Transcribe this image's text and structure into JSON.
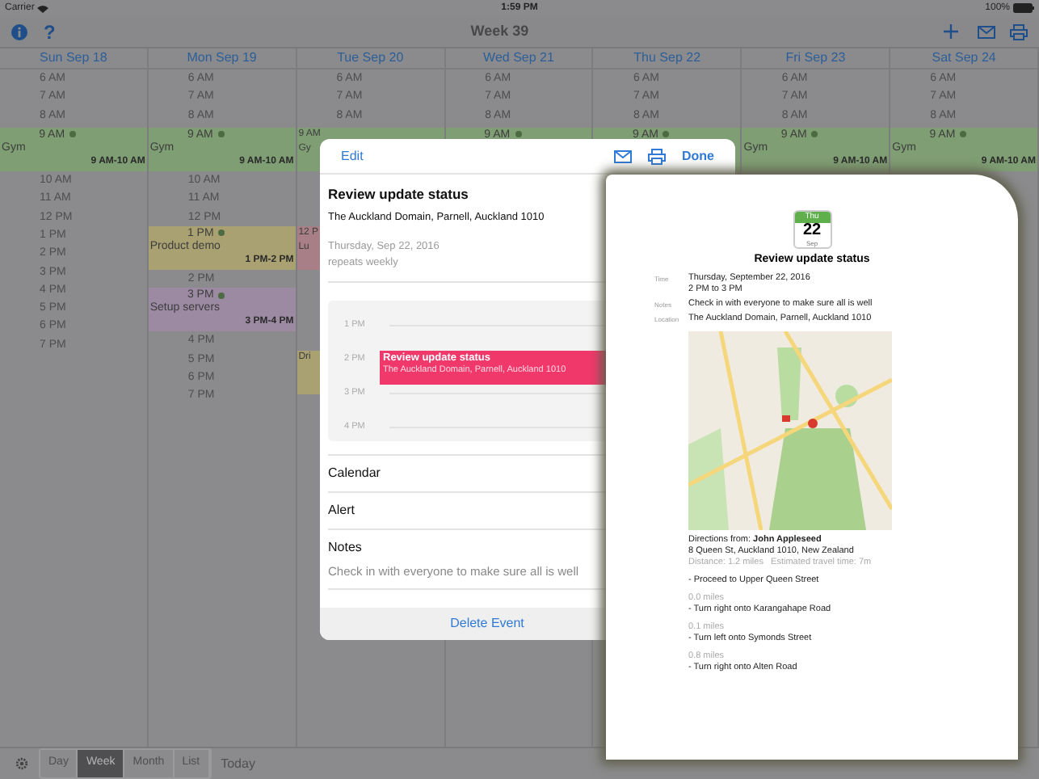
{
  "status_bar": {
    "carrier": "Carrier",
    "time": "1:59 PM",
    "battery": "100%"
  },
  "nav_bar": {
    "help": "?",
    "title": "Week 39"
  },
  "days": [
    {
      "label": "Sun Sep 18",
      "items": [
        {
          "kind": "hour",
          "text": "6 AM"
        },
        {
          "kind": "hour",
          "text": "7 AM"
        },
        {
          "kind": "hour",
          "text": "8 AM"
        },
        {
          "kind": "event",
          "label": "9 AM",
          "name": "Gym",
          "time": "9 AM-10 AM",
          "color": "#7f9e74"
        },
        {
          "kind": "hour",
          "text": "10 AM"
        },
        {
          "kind": "hour",
          "text": "11 AM"
        },
        {
          "kind": "hour",
          "text": "12 PM"
        },
        {
          "kind": "hour",
          "text": "1 PM"
        },
        {
          "kind": "hour",
          "text": "2 PM"
        },
        {
          "kind": "hour",
          "text": "3 PM"
        },
        {
          "kind": "hour",
          "text": "4 PM"
        },
        {
          "kind": "hour",
          "text": "5 PM"
        },
        {
          "kind": "hour",
          "text": "6 PM"
        },
        {
          "kind": "hour",
          "text": "7 PM"
        }
      ]
    },
    {
      "label": "Mon Sep 19",
      "items": [
        {
          "kind": "hour",
          "text": "6 AM"
        },
        {
          "kind": "hour",
          "text": "7 AM"
        },
        {
          "kind": "hour",
          "text": "8 AM"
        },
        {
          "kind": "event",
          "label": "9 AM",
          "name": "Gym",
          "time": "9 AM-10 AM",
          "color": "#7f9e74"
        },
        {
          "kind": "hour",
          "text": "10 AM"
        },
        {
          "kind": "hour",
          "text": "11 AM"
        },
        {
          "kind": "hour",
          "text": "12 PM"
        },
        {
          "kind": "event",
          "label": "1 PM",
          "name": "Product demo",
          "time": "1 PM-2 PM",
          "color": "#a9a171"
        },
        {
          "kind": "hour",
          "text": "2 PM"
        },
        {
          "kind": "event",
          "label": "3 PM",
          "name": "Setup servers",
          "time": "3 PM-4 PM",
          "color": "#9c8aa3"
        },
        {
          "kind": "hour",
          "text": "4 PM"
        },
        {
          "kind": "hour",
          "text": "5 PM"
        },
        {
          "kind": "hour",
          "text": "6 PM"
        },
        {
          "kind": "hour",
          "text": "7 PM"
        }
      ]
    },
    {
      "label": "Tue Sep 20",
      "items": [
        {
          "kind": "hour",
          "text": "6 AM"
        },
        {
          "kind": "hour",
          "text": "7 AM"
        },
        {
          "kind": "hour",
          "text": "8 AM"
        },
        {
          "kind": "event",
          "label": "9 AM",
          "name": "Gy",
          "color": "#7f9e74"
        },
        {
          "kind": "event",
          "label": "12 P",
          "name": "Lu",
          "color": "#a87f86"
        },
        {
          "kind": "event",
          "name": "Dri",
          "color": "#a9a171"
        }
      ]
    },
    {
      "label": "Wed Sep 21",
      "items": [
        {
          "kind": "hour",
          "text": "6 AM"
        },
        {
          "kind": "hour",
          "text": "7 AM"
        },
        {
          "kind": "hour",
          "text": "8 AM"
        },
        {
          "kind": "event",
          "label": "9 AM",
          "color": "#7f9e74"
        }
      ]
    },
    {
      "label": "Thu Sep 22",
      "items": [
        {
          "kind": "hour",
          "text": "6 AM"
        },
        {
          "kind": "hour",
          "text": "7 AM"
        },
        {
          "kind": "hour",
          "text": "8 AM"
        },
        {
          "kind": "event",
          "label": "9 AM",
          "color": "#7f9e74"
        }
      ]
    },
    {
      "label": "Fri Sep 23",
      "items": [
        {
          "kind": "hour",
          "text": "6 AM"
        },
        {
          "kind": "hour",
          "text": "7 AM"
        },
        {
          "kind": "hour",
          "text": "8 AM"
        },
        {
          "kind": "event",
          "label": "9 AM",
          "name": "Gym",
          "time": "9 AM-10 AM",
          "color": "#7f9e74"
        }
      ]
    },
    {
      "label": "Sat Sep 24",
      "items": [
        {
          "kind": "hour",
          "text": "6 AM"
        },
        {
          "kind": "hour",
          "text": "7 AM"
        },
        {
          "kind": "hour",
          "text": "8 AM"
        },
        {
          "kind": "event",
          "label": "9 AM",
          "name": "Gym",
          "time": "9 AM-10 AM",
          "color": "#7f9e74"
        }
      ]
    }
  ],
  "event_popover": {
    "edit": "Edit",
    "done": "Done",
    "title": "Review update status",
    "location": "The Auckland Domain, Parnell, Auckland 1010",
    "date": "Thursday, Sep 22, 2016",
    "repeat": "repeats weekly",
    "day_view": {
      "hours": [
        "1 PM",
        "2 PM",
        "3 PM",
        "4 PM"
      ],
      "event": {
        "title": "Review update status",
        "location": "The Auckland Domain, Parnell, Auckland 1010"
      }
    },
    "rows": [
      {
        "label": "Calendar"
      },
      {
        "label": "Alert"
      },
      {
        "label": "Notes",
        "value": "Check in with everyone to make sure all is well"
      }
    ],
    "delete": "Delete Event"
  },
  "print_preview": {
    "calendar_icon": {
      "weekday": "Thu",
      "day": "22",
      "month": "Sep"
    },
    "title": "Review update status",
    "fields": [
      {
        "label": "Time",
        "lines": [
          "Thursday, September 22, 2016",
          "2 PM to 3 PM"
        ]
      },
      {
        "label": "Notes",
        "lines": [
          "Check in with everyone to make sure all is well"
        ]
      },
      {
        "label": "Location",
        "lines": [
          "The Auckland Domain, Parnell, Auckland 1010"
        ]
      }
    ],
    "directions": {
      "from": "Directions from: **John Appleseed**",
      "address": "8 Queen St, Auckland 1010, New Zealand",
      "summary": "Distance: 1.2 miles   Estimated travel time: 7m",
      "steps": [
        {
          "text": "- Proceed to Upper Queen Street"
        },
        {
          "distance": "0.0 miles",
          "text": "- Turn right onto Karangahape Road"
        },
        {
          "distance": "0.1 miles",
          "text": "- Turn left onto Symonds Street"
        },
        {
          "distance": "0.8 miles",
          "text": "- Turn right onto Alten Road"
        }
      ]
    }
  },
  "toolbar": {
    "view_modes": [
      {
        "label": "Day",
        "selected": false
      },
      {
        "label": "Week",
        "selected": true
      },
      {
        "label": "Month",
        "selected": false
      },
      {
        "label": "List",
        "selected": false
      }
    ],
    "today": "Today"
  }
}
